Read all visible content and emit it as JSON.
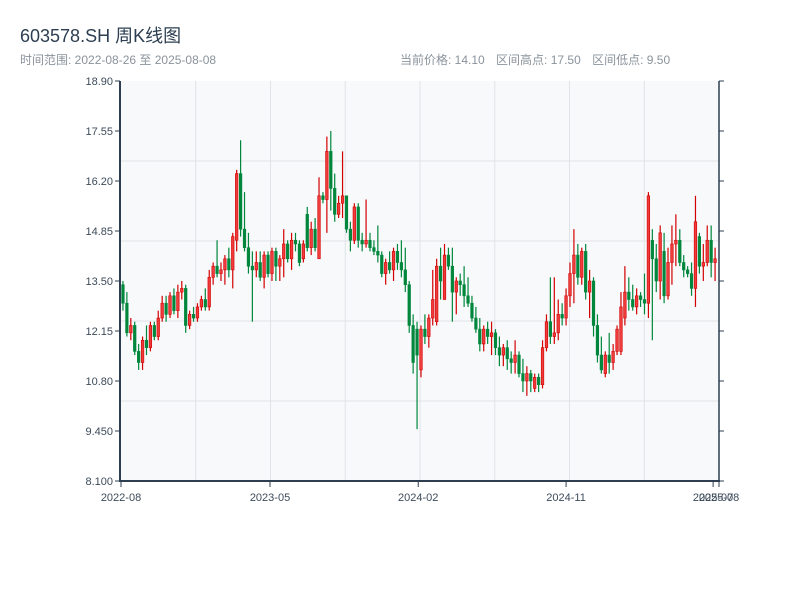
{
  "header": {
    "title": "603578.SH 周K线图",
    "range_label": "时间范围: 2022-08-26 至 2025-08-08",
    "current_price": "当前价格: 14.10",
    "range_high": "区间高点: 17.50",
    "range_low": "区间低点: 9.50"
  },
  "colors": {
    "up": "#d40000",
    "up_fill": "#ee3b3b",
    "down": "#00873c",
    "axis": "#2d3e50",
    "grid": "#e0e3e8",
    "plot_bg": "#f7f9fb"
  },
  "chart_data": {
    "type": "candlestick",
    "title": "603578.SH 周K线图",
    "interval": "weekly",
    "ylim": [
      8.1,
      18.9
    ],
    "xlim": [
      -0.5,
      152
    ],
    "y_ticks": [
      "8.100",
      "9.450",
      "10.80",
      "12.15",
      "13.50",
      "14.85",
      "16.20",
      "17.55",
      "18.90"
    ],
    "x_ticks": [
      {
        "label": "2022-08",
        "index": -0.5
      },
      {
        "label": "2023-05",
        "index": 37.5
      },
      {
        "label": "2024-02",
        "index": 75.3
      },
      {
        "label": "2024-11",
        "index": 113
      },
      {
        "label": "2025-07",
        "index": 150.5
      },
      {
        "label": "2025-08",
        "index": 152
      }
    ],
    "ohlc_fields": [
      "open",
      "high",
      "low",
      "close"
    ],
    "ohlc": [
      [
        13.4,
        13.5,
        12.7,
        12.9
      ],
      [
        12.9,
        13.2,
        12.0,
        12.1
      ],
      [
        12.1,
        12.5,
        11.9,
        12.3
      ],
      [
        12.3,
        12.4,
        11.5,
        11.6
      ],
      [
        11.6,
        11.8,
        11.1,
        11.3
      ],
      [
        11.3,
        12.0,
        11.1,
        11.9
      ],
      [
        11.9,
        12.3,
        11.5,
        11.7
      ],
      [
        11.7,
        12.4,
        11.6,
        12.3
      ],
      [
        12.3,
        12.4,
        11.9,
        12.0
      ],
      [
        12.0,
        12.7,
        11.9,
        12.5
      ],
      [
        12.5,
        13.1,
        12.4,
        12.9
      ],
      [
        12.9,
        13.1,
        12.4,
        12.6
      ],
      [
        12.6,
        13.2,
        12.5,
        13.1
      ],
      [
        13.1,
        13.3,
        12.6,
        12.7
      ],
      [
        12.7,
        13.4,
        12.5,
        13.2
      ],
      [
        13.2,
        13.5,
        13.0,
        13.3
      ],
      [
        13.3,
        13.4,
        12.1,
        12.3
      ],
      [
        12.3,
        12.7,
        12.2,
        12.6
      ],
      [
        12.6,
        12.8,
        12.4,
        12.5
      ],
      [
        12.5,
        12.9,
        12.4,
        12.8
      ],
      [
        12.8,
        13.1,
        12.7,
        13.0
      ],
      [
        13.0,
        13.3,
        12.7,
        12.8
      ],
      [
        12.8,
        13.8,
        12.7,
        13.6
      ],
      [
        13.6,
        14.0,
        13.4,
        13.9
      ],
      [
        13.9,
        14.6,
        13.6,
        13.7
      ],
      [
        13.7,
        14.0,
        13.5,
        13.8
      ],
      [
        13.8,
        14.2,
        13.4,
        14.1
      ],
      [
        14.1,
        14.4,
        13.6,
        13.8
      ],
      [
        13.8,
        14.8,
        13.3,
        14.7
      ],
      [
        14.6,
        16.5,
        14.3,
        16.4
      ],
      [
        16.4,
        17.3,
        14.7,
        14.9
      ],
      [
        14.9,
        15.9,
        14.3,
        14.4
      ],
      [
        14.4,
        14.8,
        13.7,
        13.9
      ],
      [
        13.9,
        14.3,
        12.4,
        13.8
      ],
      [
        13.8,
        14.3,
        13.6,
        14.0
      ],
      [
        14.0,
        14.3,
        13.5,
        13.6
      ],
      [
        13.6,
        14.3,
        13.3,
        14.2
      ],
      [
        14.2,
        14.3,
        13.6,
        13.7
      ],
      [
        13.7,
        14.4,
        13.5,
        14.3
      ],
      [
        14.3,
        14.4,
        13.5,
        13.9
      ],
      [
        13.9,
        14.2,
        13.5,
        14.1
      ],
      [
        14.1,
        14.9,
        13.6,
        14.5
      ],
      [
        14.5,
        14.6,
        14.0,
        14.1
      ],
      [
        14.1,
        14.8,
        13.8,
        14.6
      ],
      [
        14.6,
        14.8,
        14.3,
        14.5
      ],
      [
        14.5,
        14.6,
        13.9,
        14.0
      ],
      [
        14.1,
        14.6,
        14.0,
        14.5
      ],
      [
        15.3,
        15.5,
        14.3,
        14.4
      ],
      [
        14.4,
        15.1,
        14.2,
        14.9
      ],
      [
        14.9,
        15.2,
        14.3,
        14.4
      ],
      [
        14.1,
        16.3,
        14.1,
        15.8
      ],
      [
        15.8,
        15.9,
        15.6,
        15.7
      ],
      [
        15.7,
        17.4,
        14.8,
        17.0
      ],
      [
        17.0,
        17.55,
        15.4,
        16.0
      ],
      [
        16.0,
        16.4,
        15.1,
        15.3
      ],
      [
        15.3,
        15.8,
        15.2,
        15.6
      ],
      [
        15.6,
        17.0,
        15.2,
        15.8
      ],
      [
        15.8,
        15.8,
        14.8,
        14.9
      ],
      [
        14.9,
        15.1,
        14.3,
        14.6
      ],
      [
        14.6,
        15.6,
        14.5,
        15.5
      ],
      [
        15.5,
        15.6,
        14.4,
        14.6
      ],
      [
        14.6,
        14.8,
        14.3,
        14.5
      ],
      [
        14.5,
        15.7,
        14.4,
        14.6
      ],
      [
        14.6,
        14.8,
        14.3,
        14.4
      ],
      [
        14.4,
        14.6,
        14.2,
        14.3
      ],
      [
        14.3,
        15.0,
        14.0,
        14.2
      ],
      [
        14.2,
        14.3,
        13.6,
        13.7
      ],
      [
        13.7,
        14.1,
        13.4,
        14.0
      ],
      [
        14.0,
        14.3,
        13.7,
        13.8
      ],
      [
        13.8,
        14.4,
        13.5,
        14.3
      ],
      [
        14.3,
        14.5,
        13.8,
        14.0
      ],
      [
        14.0,
        14.6,
        13.6,
        13.8
      ],
      [
        13.8,
        14.4,
        13.2,
        13.4
      ],
      [
        13.4,
        13.5,
        12.1,
        12.3
      ],
      [
        12.3,
        12.6,
        11.0,
        11.3
      ],
      [
        12.2,
        12.4,
        9.5,
        11.5
      ],
      [
        11.1,
        12.3,
        10.9,
        12.2
      ],
      [
        12.2,
        12.6,
        11.8,
        12.0
      ],
      [
        12.0,
        12.6,
        11.7,
        12.5
      ],
      [
        12.5,
        13.8,
        12.3,
        13.0
      ],
      [
        12.4,
        14.1,
        12.3,
        13.9
      ],
      [
        13.9,
        14.4,
        13.0,
        13.5
      ],
      [
        13.0,
        14.5,
        13.0,
        14.2
      ],
      [
        14.2,
        14.4,
        13.8,
        13.9
      ],
      [
        13.9,
        14.4,
        12.4,
        13.2
      ],
      [
        13.2,
        13.6,
        12.6,
        13.5
      ],
      [
        13.5,
        13.7,
        13.1,
        13.4
      ],
      [
        13.4,
        13.9,
        12.8,
        13.1
      ],
      [
        13.1,
        13.6,
        12.8,
        12.9
      ],
      [
        12.9,
        13.1,
        12.4,
        12.5
      ],
      [
        12.5,
        12.8,
        12.1,
        12.2
      ],
      [
        12.2,
        12.5,
        11.6,
        11.8
      ],
      [
        11.8,
        12.3,
        11.6,
        12.2
      ],
      [
        12.2,
        12.4,
        11.8,
        12.0
      ],
      [
        12.0,
        12.4,
        11.5,
        12.1
      ],
      [
        12.1,
        12.2,
        11.5,
        11.7
      ],
      [
        11.7,
        12.0,
        11.2,
        11.5
      ],
      [
        11.5,
        11.8,
        11.2,
        11.7
      ],
      [
        11.7,
        11.9,
        11.1,
        11.4
      ],
      [
        11.4,
        11.6,
        11.0,
        11.3
      ],
      [
        11.3,
        11.9,
        11.0,
        11.5
      ],
      [
        11.5,
        11.6,
        10.9,
        11.0
      ],
      [
        11.0,
        11.4,
        10.5,
        10.8
      ],
      [
        10.8,
        11.2,
        10.4,
        11.0
      ],
      [
        11.0,
        11.1,
        10.5,
        10.8
      ],
      [
        10.6,
        11.0,
        10.5,
        10.9
      ],
      [
        10.9,
        11.0,
        10.5,
        10.7
      ],
      [
        10.7,
        11.9,
        10.6,
        11.7
      ],
      [
        11.7,
        12.6,
        11.6,
        12.4
      ],
      [
        12.4,
        13.6,
        11.8,
        12.0
      ],
      [
        12.0,
        13.6,
        11.8,
        12.1
      ],
      [
        12.1,
        13.0,
        11.9,
        12.6
      ],
      [
        12.6,
        12.9,
        12.3,
        12.5
      ],
      [
        12.5,
        13.3,
        12.3,
        13.1
      ],
      [
        13.1,
        14.0,
        12.8,
        13.7
      ],
      [
        13.7,
        14.9,
        12.9,
        14.2
      ],
      [
        14.2,
        14.5,
        13.4,
        13.6
      ],
      [
        13.6,
        14.4,
        13.4,
        14.3
      ],
      [
        14.3,
        14.5,
        13.0,
        13.2
      ],
      [
        13.2,
        13.8,
        12.5,
        13.5
      ],
      [
        13.5,
        13.6,
        12.0,
        12.3
      ],
      [
        12.3,
        12.6,
        11.3,
        11.5
      ],
      [
        11.5,
        12.0,
        11.0,
        11.1
      ],
      [
        11.0,
        11.6,
        10.9,
        11.5
      ],
      [
        11.5,
        12.1,
        11.0,
        11.3
      ],
      [
        11.3,
        11.8,
        11.1,
        11.6
      ],
      [
        11.6,
        12.3,
        11.5,
        12.2
      ],
      [
        11.6,
        13.2,
        11.5,
        12.8
      ],
      [
        12.5,
        13.9,
        12.3,
        13.2
      ],
      [
        13.2,
        13.6,
        12.7,
        13.0
      ],
      [
        13.0,
        13.4,
        12.7,
        12.8
      ],
      [
        12.8,
        13.3,
        12.6,
        13.1
      ],
      [
        13.1,
        13.2,
        12.8,
        13.0
      ],
      [
        13.0,
        13.7,
        12.6,
        12.9
      ],
      [
        12.9,
        15.9,
        12.5,
        15.8
      ],
      [
        14.6,
        14.9,
        11.9,
        14.1
      ],
      [
        14.1,
        14.5,
        13.2,
        13.5
      ],
      [
        13.5,
        15.0,
        13.0,
        14.8
      ],
      [
        14.3,
        14.8,
        12.9,
        13.1
      ],
      [
        13.1,
        14.4,
        13.0,
        14.0
      ],
      [
        14.0,
        15.0,
        13.4,
        14.5
      ],
      [
        14.5,
        15.3,
        13.9,
        14.6
      ],
      [
        14.6,
        14.9,
        13.9,
        14.0
      ],
      [
        14.0,
        14.2,
        13.6,
        13.8
      ],
      [
        13.8,
        13.9,
        13.6,
        13.7
      ],
      [
        13.7,
        14.0,
        13.1,
        13.3
      ],
      [
        13.3,
        15.8,
        12.8,
        15.1
      ],
      [
        14.7,
        14.8,
        13.7,
        13.9
      ],
      [
        13.9,
        14.5,
        13.5,
        14.0
      ],
      [
        14.0,
        15.0,
        13.9,
        14.6
      ],
      [
        14.6,
        15.0,
        13.6,
        14.0
      ],
      [
        14.0,
        14.4,
        13.5,
        14.1
      ]
    ]
  }
}
